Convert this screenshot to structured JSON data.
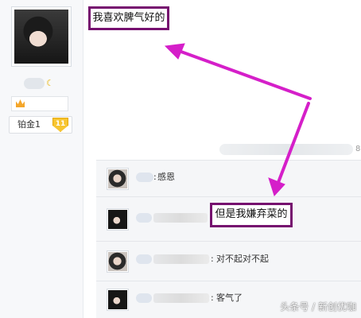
{
  "profile": {
    "rank_label": "铂金1",
    "rank_badge_number": "11"
  },
  "post": {
    "highlight_text": "我喜欢脾气好的"
  },
  "meta": {
    "floor_fragment": "8"
  },
  "replies": [
    {
      "separator": ":",
      "text": "感恩"
    },
    {
      "highlight_text": "但是我嫌弃菜的"
    },
    {
      "separator": ":",
      "text": "对不起对不起"
    },
    {
      "separator": ":",
      "text": "客气了"
    }
  ],
  "colors": {
    "highlight_border": "#76106f",
    "arrow": "#d51fc9",
    "rank_badge": "#f7c531"
  },
  "icons": [
    "avatar",
    "moon-icon",
    "crown-icon",
    "rank-badge-icon",
    "arrow-icon"
  ],
  "watermark": "头条号 / 新创优咖"
}
